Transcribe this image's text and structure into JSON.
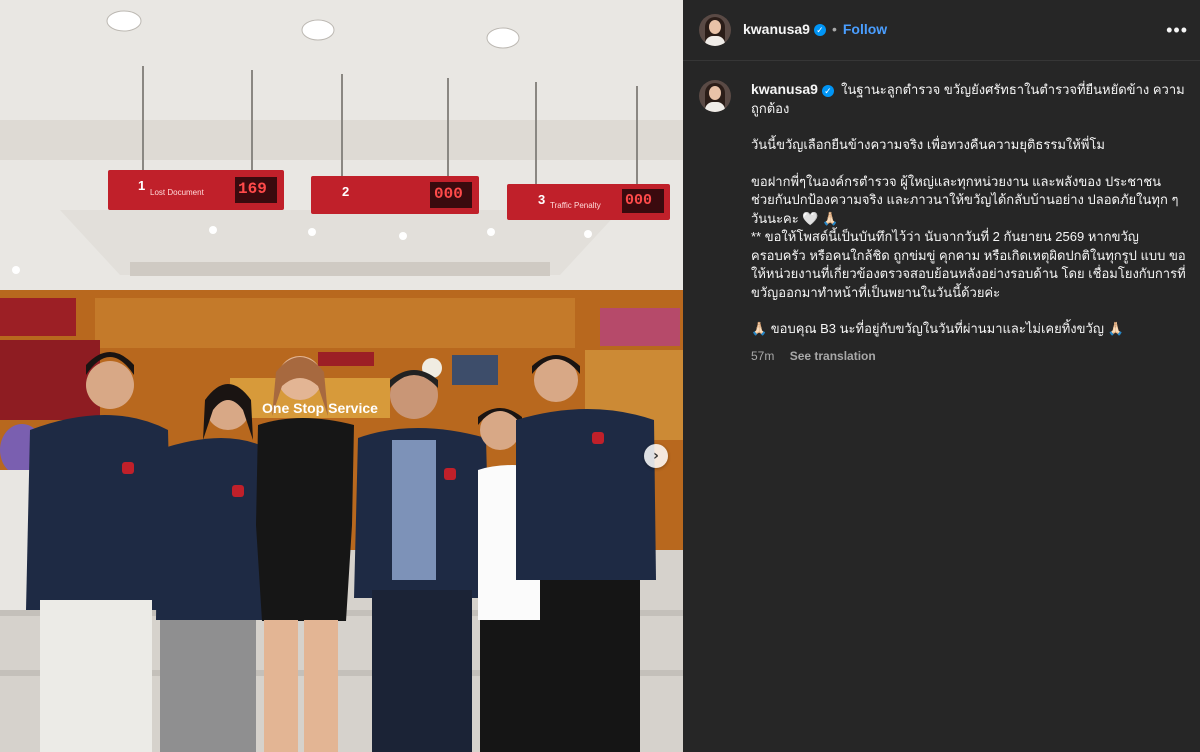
{
  "header": {
    "username": "kwanusa9",
    "follow_label": "Follow",
    "separator": "•",
    "more": "•••"
  },
  "post": {
    "username": "kwanusa9",
    "caption_line1": "ในฐานะลูกตำรวจ ขวัญยังศรัทธาในตำรวจที่ยืนหยัดข้าง ความถูกต้อง",
    "caption_line2": "วันนี้ขวัญเลือกยืนข้างความจริง เพื่อทวงคืนความยุติธรรมให้พี่โม",
    "caption_line3": "ขอฝากพี่ๆในองค์กรตำรวจ ผู้ใหญ่และทุกหน่วยงาน และพลังของ ประชาชน ช่วยกันปกป้องความจริง และภาวนาให้ขวัญได้กลับบ้านอย่าง ปลอดภัยในทุก ๆ วันนะคะ 🤍 🙏🏻",
    "caption_line4": "** ขอให้โพสต์นี้เป็นบันทึกไว้ว่า นับจากวันที่ 2 กันยายน 2569 หากขวัญ ครอบครัว หรือคนใกล้ชิด ถูกข่มขู่ คุกคาม หรือเกิดเหตุผิดปกติในทุกรูป แบบ ขอให้หน่วยงานที่เกี่ยวข้องตรวจสอบย้อนหลังอย่างรอบด้าน โดย เชื่อมโยงกับการที่ขวัญออกมาทำหน้าที่เป็นพยานในวันนี้ด้วยค่ะ",
    "caption_line5": "🙏🏻 ขอบคุณ B3 นะที่อยู่กับขวัญในวันที่ผ่านมาและไม่เคยทิ้งขวัญ 🙏🏻",
    "time": "57m",
    "see_translation": "See translation"
  },
  "photo": {
    "counter_1_label": "1",
    "counter_1_sub": "Lost Document",
    "counter_1_value": "169",
    "counter_2_label": "2",
    "counter_2_value": "000",
    "counter_3_label": "3",
    "counter_3_sub": "Traffic Penalty",
    "counter_3_value": "000",
    "sign_main": "One Stop Service",
    "next_glyph": "›"
  },
  "colors": {
    "panel_bg": "#262626",
    "accent_blue": "#4a9eff",
    "verified": "#0095f6",
    "counter_red": "#c0202a"
  }
}
